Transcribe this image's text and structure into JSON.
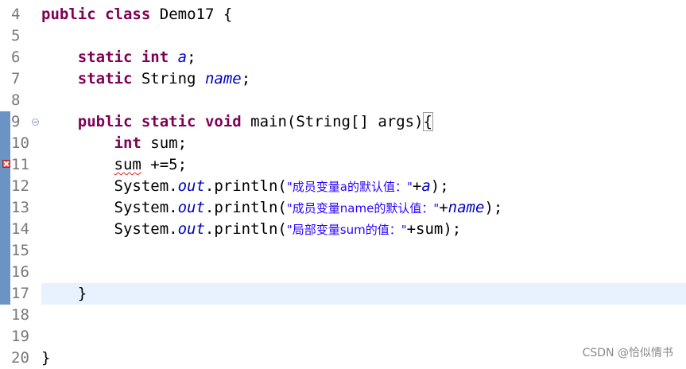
{
  "editor": {
    "lines": [
      {
        "num": "4",
        "tokens": [
          "public",
          "class",
          "Demo17 {"
        ]
      },
      {
        "num": "5",
        "tokens": []
      },
      {
        "num": "6",
        "tokens": [
          "static",
          "int",
          "a",
          ";"
        ]
      },
      {
        "num": "7",
        "tokens": [
          "static",
          "String ",
          "name",
          ";"
        ]
      },
      {
        "num": "8",
        "tokens": []
      },
      {
        "num": "9",
        "tokens": [
          "public",
          "static",
          "void",
          "main(String[] args)",
          "{"
        ]
      },
      {
        "num": "10",
        "tokens": [
          "int",
          "sum;"
        ]
      },
      {
        "num": "11",
        "tokens": [
          "sum",
          " +=5;"
        ]
      },
      {
        "num": "12",
        "tokens": [
          "System.",
          "out",
          ".println(",
          "\"成员变量a的默认值：\"",
          "+",
          "a",
          ");"
        ]
      },
      {
        "num": "13",
        "tokens": [
          "System.",
          "out",
          ".println(",
          "\"成员变量name的默认值：\"",
          "+",
          "name",
          ");"
        ]
      },
      {
        "num": "14",
        "tokens": [
          "System.",
          "out",
          ".println(",
          "\"局部变量sum的值：\"",
          "+sum);"
        ]
      },
      {
        "num": "15",
        "tokens": []
      },
      {
        "num": "16",
        "tokens": []
      },
      {
        "num": "17",
        "tokens": [
          "}"
        ]
      },
      {
        "num": "18",
        "tokens": []
      },
      {
        "num": "19",
        "tokens": []
      },
      {
        "num": "20",
        "tokens": [
          "}"
        ]
      }
    ],
    "current_line": "17",
    "error_line": "11"
  },
  "watermark": "CSDN @恰似情书",
  "colors": {
    "keyword": "#7f0055",
    "field": "#0000c0",
    "string": "#2a00ff",
    "line_number": "#787878",
    "current_line_bg": "#e8f2fe",
    "change_marker": "#6b94c4",
    "error": "#d9534f"
  }
}
